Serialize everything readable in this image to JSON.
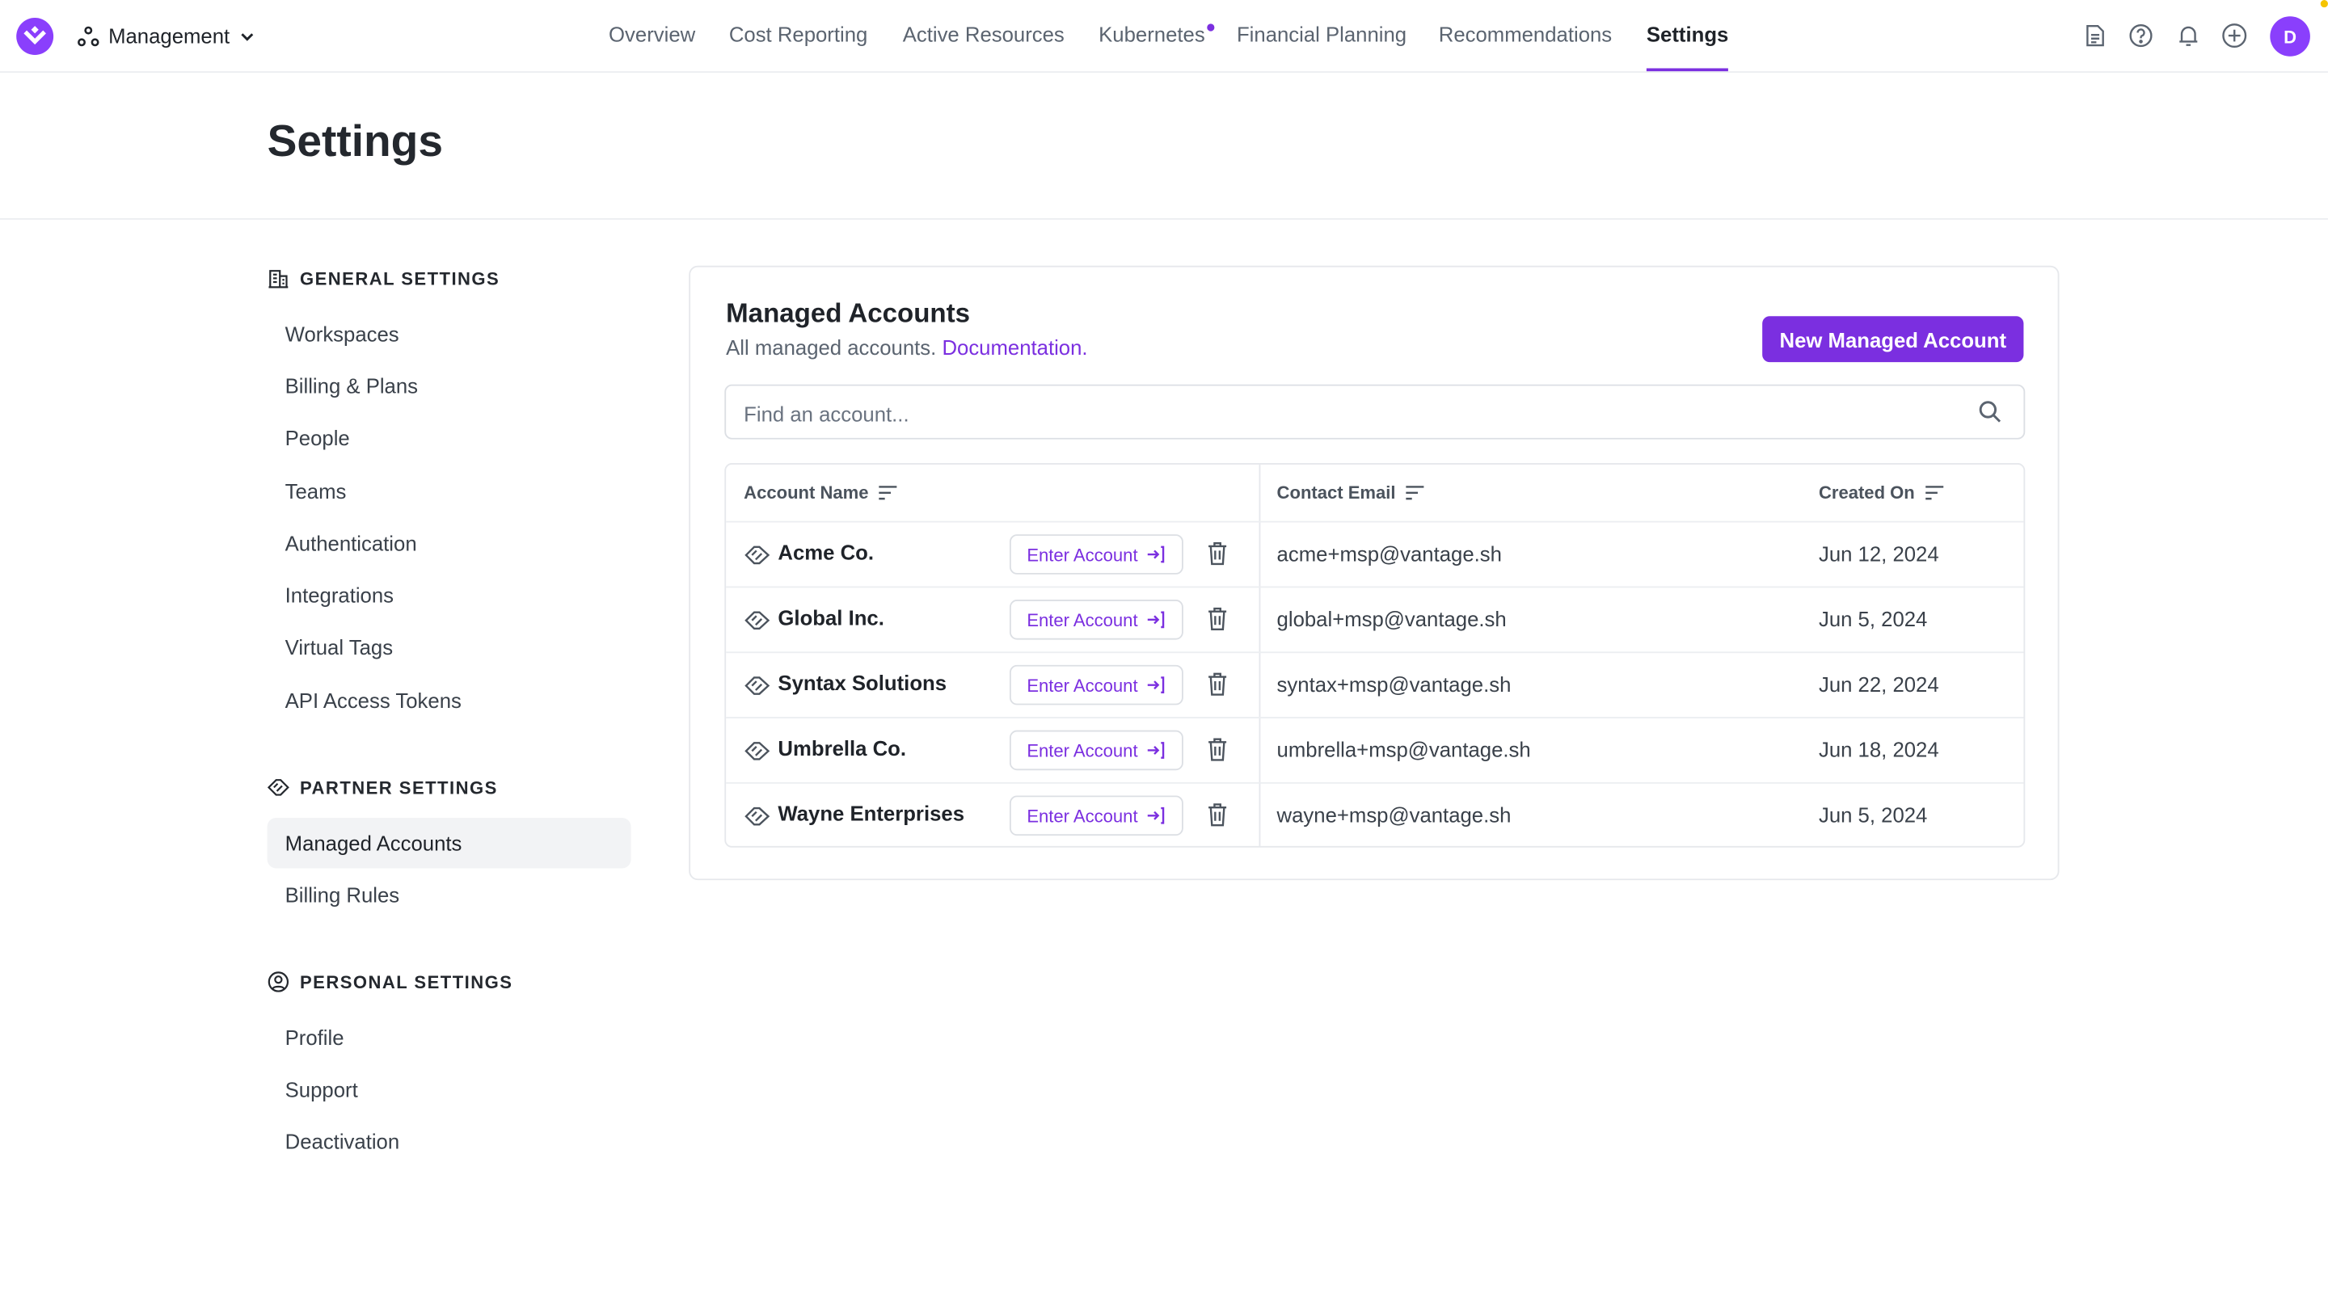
{
  "nav": {
    "workspace": "Management",
    "tabs": [
      {
        "label": "Overview"
      },
      {
        "label": "Cost Reporting"
      },
      {
        "label": "Active Resources"
      },
      {
        "label": "Kubernetes"
      },
      {
        "label": "Financial Planning"
      },
      {
        "label": "Recommendations"
      },
      {
        "label": "Settings"
      }
    ],
    "active_tab": "Settings",
    "avatar_initial": "D"
  },
  "page": {
    "title": "Settings"
  },
  "sidebar": {
    "general": {
      "title": "GENERAL SETTINGS",
      "items": [
        "Workspaces",
        "Billing & Plans",
        "People",
        "Teams",
        "Authentication",
        "Integrations",
        "Virtual Tags",
        "API Access Tokens"
      ]
    },
    "partner": {
      "title": "PARTNER SETTINGS",
      "items": [
        "Managed Accounts",
        "Billing Rules"
      ]
    },
    "personal": {
      "title": "PERSONAL SETTINGS",
      "items": [
        "Profile",
        "Support",
        "Deactivation"
      ]
    },
    "active_item": "Managed Accounts"
  },
  "card": {
    "title": "Managed Accounts",
    "subtitle": "All managed accounts.",
    "doc_link": "Documentation.",
    "new_button": "New Managed Account",
    "search_placeholder": "Find an account..."
  },
  "table": {
    "columns": [
      "Account Name",
      "Contact Email",
      "Created On"
    ],
    "enter_label": "Enter Account",
    "rows": [
      {
        "name": "Acme Co.",
        "email": "acme+msp@vantage.sh",
        "created": "Jun 12, 2024"
      },
      {
        "name": "Global Inc.",
        "email": "global+msp@vantage.sh",
        "created": "Jun 5, 2024"
      },
      {
        "name": "Syntax Solutions",
        "email": "syntax+msp@vantage.sh",
        "created": "Jun 22, 2024"
      },
      {
        "name": "Umbrella Co.",
        "email": "umbrella+msp@vantage.sh",
        "created": "Jun 18, 2024"
      },
      {
        "name": "Wayne Enterprises",
        "email": "wayne+msp@vantage.sh",
        "created": "Jun 5, 2024"
      }
    ]
  },
  "colors": {
    "accent": "#7b2fe0",
    "brand": "#8a3ffc"
  }
}
